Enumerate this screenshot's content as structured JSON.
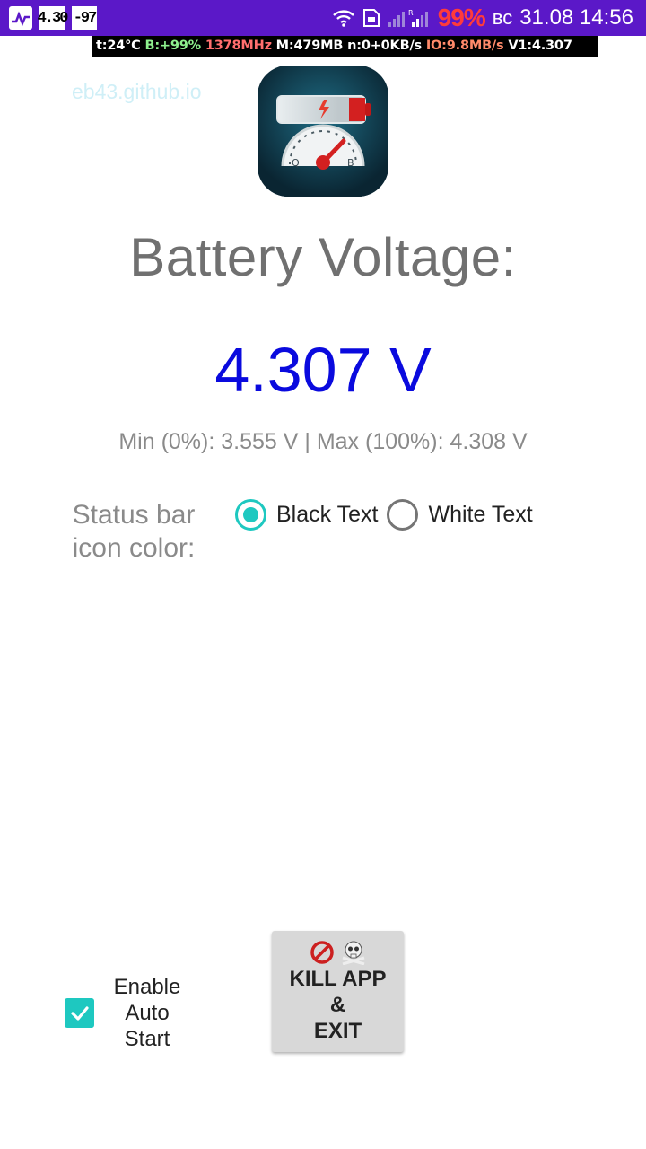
{
  "status_bar": {
    "tile1": "4.30",
    "tile2": "-97",
    "battery_percent": "99%",
    "day": "вс",
    "date_time": "31.08 14:56"
  },
  "overlay": {
    "temp": "t:24°C",
    "battery": "B:+99%",
    "cpu": "1378MHz",
    "mem": "M:479MB",
    "net": "n:0+0KB/s",
    "io": "IO:9.8MB/s",
    "volt": "V1:4.307"
  },
  "app": {
    "website": "eb43.github.io",
    "icon_name": "battery-gauge-icon",
    "title": "Battery Voltage:",
    "voltage": "4.307 V",
    "range": "Min (0%): 3.555 V | Max (100%): 4.308 V"
  },
  "status_color": {
    "label_line1": "Status bar",
    "label_line2": "icon color:",
    "options": [
      {
        "label": "Black Text",
        "checked": true
      },
      {
        "label": "White Text",
        "checked": false
      }
    ]
  },
  "auto_start": {
    "line1": "Enable",
    "line2": "Auto",
    "line3": "Start",
    "checked": true
  },
  "kill_button": {
    "line1": "KILL APP",
    "line2": "&",
    "line3": "EXIT"
  },
  "colors": {
    "status_bar_bg": "#5b18c8",
    "accent": "#1ec8c0",
    "voltage": "#0a0ade",
    "battery_percent": "#ff3b3b"
  }
}
